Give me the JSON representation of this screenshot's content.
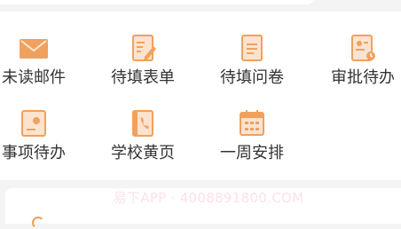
{
  "colors": {
    "icon_orange": "#f0a15e",
    "icon_orange_light": "#fbe3cf",
    "label_text": "#333333",
    "page_background": "#f4f4f4",
    "card_background": "#ffffff"
  },
  "menu": {
    "items": [
      {
        "label": "未读邮件",
        "icon": "envelope-icon"
      },
      {
        "label": "待填表单",
        "icon": "form-edit-icon"
      },
      {
        "label": "待填问卷",
        "icon": "questionnaire-icon"
      },
      {
        "label": "审批待办",
        "icon": "approval-icon"
      },
      {
        "label": "事项待办",
        "icon": "task-icon"
      },
      {
        "label": "学校黄页",
        "icon": "phonebook-icon"
      },
      {
        "label": "一周安排",
        "icon": "calendar-icon"
      }
    ]
  },
  "watermark": {
    "text": "易下APP · 4008891800.COM"
  }
}
